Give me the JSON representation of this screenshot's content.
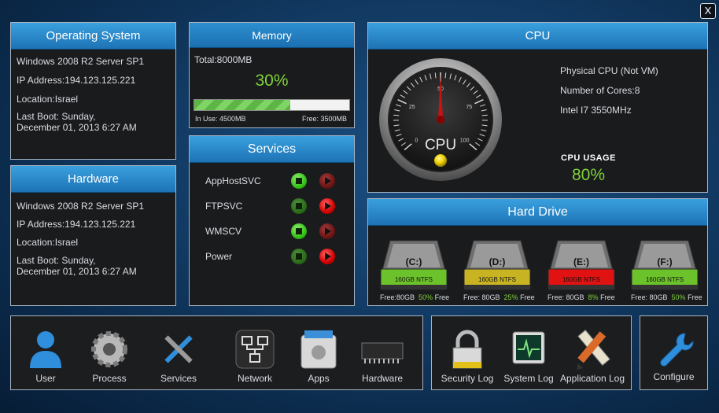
{
  "window": {
    "close_label": "X"
  },
  "os_panel": {
    "title": "Operating System",
    "os": "Windows 2008 R2 Server SP1",
    "ip": "IP Address:194.123.125.221",
    "location": "Location:Israel",
    "last_boot_1": "Last Boot: Sunday,",
    "last_boot_2": "December 01, 2013 6:27 AM"
  },
  "hardware_panel": {
    "title": "Hardware",
    "os": "Windows 2008 R2 Server SP1",
    "ip": "IP Address:194.123.125.221",
    "location": "Location:Israel",
    "last_boot_1": "Last Boot: Sunday,",
    "last_boot_2": "December 01, 2013 6:27 AM"
  },
  "memory": {
    "title": "Memory",
    "total": "Total:8000MB",
    "percent_label": "30%",
    "percent_value": 0.62,
    "in_use": "In Use: 4500MB",
    "free": "Free: 3500MB"
  },
  "services": {
    "title": "Services",
    "items": [
      {
        "name": "AppHostSVC",
        "running": true
      },
      {
        "name": "FTPSVC",
        "running": false
      },
      {
        "name": "WMSCV",
        "running": true
      },
      {
        "name": "Power",
        "running": false
      }
    ]
  },
  "cpu": {
    "title": "CPU",
    "physical": "Physical CPU (Not VM)",
    "cores": "Number of Cores:8",
    "model": "Intel I7 3550MHz",
    "usage_label": "CPU USAGE",
    "usage_value": "80%",
    "gauge_label": "CPU",
    "gauge_ticks": [
      "0",
      "25",
      "50",
      "75",
      "100"
    ],
    "gauge_value": 50
  },
  "hard_drive": {
    "title": "Hard Drive",
    "drives": [
      {
        "letter": "(C:)",
        "size": "160GB NTFS",
        "free": "Free:80GB",
        "pct": "50%",
        "free_suffix": "Free",
        "color": "#6cc22a"
      },
      {
        "letter": "(D:)",
        "size": "160GB NTFS",
        "free": "Free: 80GB",
        "pct": "25%",
        "free_suffix": "Free",
        "color": "#c8b423"
      },
      {
        "letter": "(E:)",
        "size": "160GB NTFS",
        "free": "Free: 80GB",
        "pct": "8%",
        "free_suffix": "Free",
        "color": "#e01212"
      },
      {
        "letter": "(F:)",
        "size": "160GB NTFS",
        "free": "Free: 80GB",
        "pct": "50%",
        "free_suffix": "Free",
        "color": "#6cc22a"
      }
    ]
  },
  "toolbar": {
    "main": [
      {
        "label": "User",
        "icon": "user-icon"
      },
      {
        "label": "Process",
        "icon": "gear-icon"
      },
      {
        "label": "Services",
        "icon": "tools-icon"
      },
      {
        "label": "Network",
        "icon": "network-icon"
      },
      {
        "label": "Apps",
        "icon": "apps-icon"
      },
      {
        "label": "Hardware",
        "icon": "chip-icon"
      }
    ],
    "logs": [
      {
        "label": "Security Log",
        "icon": "lock-icon"
      },
      {
        "label": "System Log",
        "icon": "monitor-icon"
      },
      {
        "label": "Application Log",
        "icon": "pencil-ruler-icon"
      }
    ],
    "configure": {
      "label": "Configure",
      "icon": "wrench-icon"
    }
  }
}
